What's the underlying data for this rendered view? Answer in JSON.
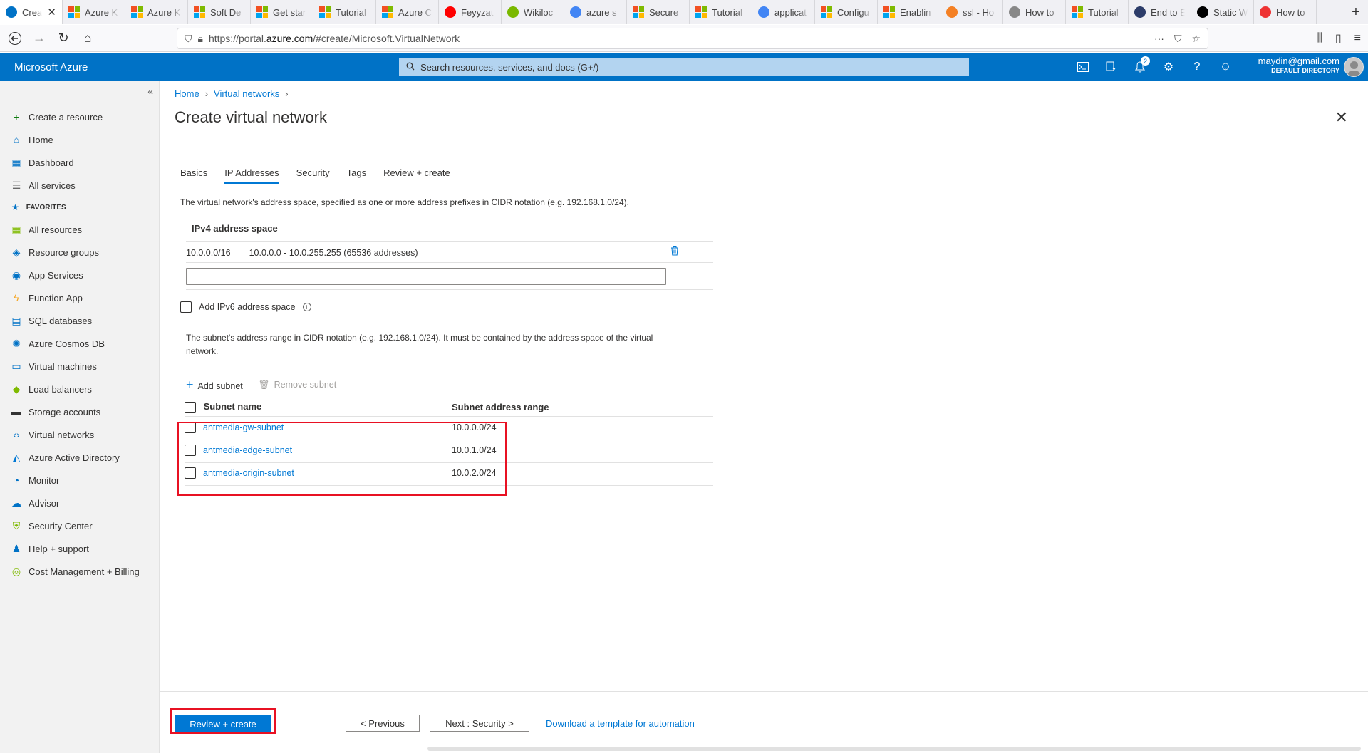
{
  "browser": {
    "tabs": [
      {
        "title": "Crea",
        "fav": "azure-logo",
        "active": true
      },
      {
        "title": "Azure K",
        "fav": "ms"
      },
      {
        "title": "Azure K",
        "fav": "ms"
      },
      {
        "title": "Soft De",
        "fav": "ms"
      },
      {
        "title": "Get star",
        "fav": "ms"
      },
      {
        "title": "Tutorial",
        "fav": "ms"
      },
      {
        "title": "Azure C",
        "fav": "ms"
      },
      {
        "title": "Feyyzat",
        "fav": "youtube"
      },
      {
        "title": "Wikiloc",
        "fav": "wikiloc"
      },
      {
        "title": "azure s",
        "fav": "google"
      },
      {
        "title": "Secure",
        "fav": "ms"
      },
      {
        "title": "Tutorial",
        "fav": "ms"
      },
      {
        "title": "applicat",
        "fav": "google"
      },
      {
        "title": "Configu",
        "fav": "ms"
      },
      {
        "title": "Enablin",
        "fav": "ms"
      },
      {
        "title": "ssl - Ho",
        "fav": "stackoverflow"
      },
      {
        "title": "How to",
        "fav": "cloud"
      },
      {
        "title": "Tutorial",
        "fav": "ms"
      },
      {
        "title": "End to E",
        "fav": "letsencrypt"
      },
      {
        "title": "Static W",
        "fav": "medium"
      },
      {
        "title": "How to",
        "fav": "mail"
      }
    ],
    "url_prefix": "https://portal.",
    "url_domain": "azure.com",
    "url_suffix": "/#create/Microsoft.VirtualNetwork"
  },
  "header": {
    "brand": "Microsoft Azure",
    "search_placeholder": "Search resources, services, and docs (G+/)",
    "notifications_count": "2",
    "account_email": "maydin@gmail.com",
    "account_directory": "DEFAULT DIRECTORY"
  },
  "sidebar": {
    "top_items": [
      {
        "label": "Create a resource",
        "icon": "plus-icon"
      },
      {
        "label": "Home",
        "icon": "home-icon"
      },
      {
        "label": "Dashboard",
        "icon": "dashboard-icon"
      },
      {
        "label": "All services",
        "icon": "list-icon"
      }
    ],
    "favorites_label": "FAVORITES",
    "favorites": [
      {
        "label": "All resources",
        "icon": "grid-icon"
      },
      {
        "label": "Resource groups",
        "icon": "resource-group-icon"
      },
      {
        "label": "App Services",
        "icon": "app-services-icon"
      },
      {
        "label": "Function App",
        "icon": "function-icon"
      },
      {
        "label": "SQL databases",
        "icon": "sql-icon"
      },
      {
        "label": "Azure Cosmos DB",
        "icon": "cosmos-icon"
      },
      {
        "label": "Virtual machines",
        "icon": "vm-icon"
      },
      {
        "label": "Load balancers",
        "icon": "load-balancer-icon"
      },
      {
        "label": "Storage accounts",
        "icon": "storage-icon"
      },
      {
        "label": "Virtual networks",
        "icon": "vnet-icon"
      },
      {
        "label": "Azure Active Directory",
        "icon": "aad-icon"
      },
      {
        "label": "Monitor",
        "icon": "monitor-icon"
      },
      {
        "label": "Advisor",
        "icon": "advisor-icon"
      },
      {
        "label": "Security Center",
        "icon": "security-icon"
      },
      {
        "label": "Help + support",
        "icon": "help-icon"
      },
      {
        "label": "Cost Management + Billing",
        "icon": "cost-icon"
      }
    ]
  },
  "breadcrumb": {
    "home": "Home",
    "parent": "Virtual networks"
  },
  "page": {
    "title": "Create virtual network",
    "tabs": [
      "Basics",
      "IP Addresses",
      "Security",
      "Tags",
      "Review + create"
    ],
    "active_tab": "IP Addresses",
    "address_space_desc": "The virtual network's address space, specified as one or more address prefixes in CIDR notation (e.g. 192.168.1.0/24).",
    "ipv4_header": "IPv4 address space",
    "ipv4_cidr": "10.0.0.0/16",
    "ipv4_range": "10.0.0.0 - 10.0.255.255 (65536 addresses)",
    "ipv4_input_value": "",
    "ipv6_label": "Add IPv6 address space",
    "ipv6_checked": false,
    "subnet_desc": "The subnet's address range in CIDR notation (e.g. 192.168.1.0/24). It must be contained by the address space of the virtual network.",
    "add_subnet": "Add subnet",
    "remove_subnet": "Remove subnet",
    "col_name": "Subnet name",
    "col_range": "Subnet address range",
    "subnets": [
      {
        "name": "antmedia-gw-subnet",
        "range": "10.0.0.0/24"
      },
      {
        "name": "antmedia-edge-subnet",
        "range": "10.0.1.0/24"
      },
      {
        "name": "antmedia-origin-subnet",
        "range": "10.0.2.0/24"
      }
    ]
  },
  "footer": {
    "review_create": "Review + create",
    "previous": "< Previous",
    "next": "Next : Security >",
    "download": "Download a template for automation"
  },
  "colors": {
    "azure_blue": "#0072c6",
    "link_blue": "#0078d4",
    "highlight_red": "#e81123"
  }
}
